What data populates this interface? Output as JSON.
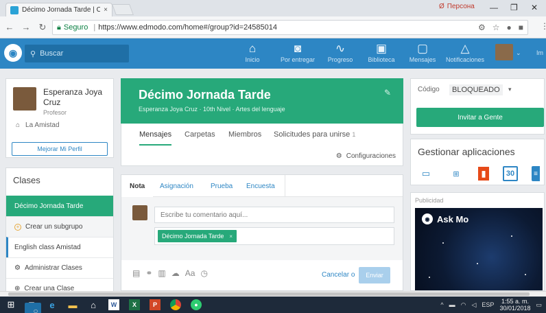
{
  "browser": {
    "tab_title": "Décimo Jornada Tarde | C",
    "tab_close": "×",
    "profile_badge": "Персона",
    "win_minimize": "—",
    "win_maximize": "❐",
    "win_close": "✕",
    "secure_label": "Seguro",
    "url": "https://www.edmodo.com/home#/group?id=24585014"
  },
  "nav": {
    "search_placeholder": "Buscar",
    "items": [
      {
        "label": "Inicio",
        "icon": "home-icon"
      },
      {
        "label": "Por entregar",
        "icon": "camera-icon"
      },
      {
        "label": "Progreso",
        "icon": "progress-icon"
      },
      {
        "label": "Biblioteca",
        "icon": "library-icon"
      },
      {
        "label": "Mensajes",
        "icon": "message-icon"
      },
      {
        "label": "Notificaciones",
        "icon": "bell-icon"
      }
    ],
    "more_label": "Im"
  },
  "profile": {
    "name": "Esperanza Joya Cruz",
    "role": "Profesor",
    "school": "La Amistad",
    "improve_button": "Mejorar Mi Perfil"
  },
  "classes": {
    "title": "Clases",
    "items": [
      {
        "label": "Décimo Jornada Tarde"
      },
      {
        "label": "Crear un subgrupo"
      },
      {
        "label": "English class Amistad"
      },
      {
        "label": "Administrar Clases"
      },
      {
        "label": "Crear una Clase"
      }
    ]
  },
  "group": {
    "title": "Décimo Jornada Tarde",
    "subtitle": "Esperanza Joya Cruz · 10th Nivel · Artes del lenguaje",
    "tabs": [
      {
        "label": "Mensajes"
      },
      {
        "label": "Carpetas"
      },
      {
        "label": "Miembros"
      },
      {
        "label": "Solicitudes para unirse"
      }
    ],
    "requests_count": "1",
    "settings": "Configuraciones"
  },
  "composer": {
    "tabs": [
      "Nota",
      "Asignación",
      "Prueba",
      "Encuesta"
    ],
    "placeholder": "Escribe tu comentario aquí...",
    "recipient": "Décimo Jornada Tarde",
    "recipient_remove": "×",
    "cancel": "Cancelar",
    "or": "o",
    "send": "Enviar"
  },
  "code": {
    "label": "Código",
    "value": "BLOQUEADO",
    "invite_button": "Invitar a Gente"
  },
  "apps": {
    "title": "Gestionar aplicaciones",
    "calendar_number": "30"
  },
  "ad": {
    "label": "Publicidad",
    "brand": "Ask Mo"
  },
  "taskbar": {
    "lang": "ESP",
    "time": "1:55 a. m.",
    "date": "30/01/2018"
  },
  "colors": {
    "brand_blue": "#2d86c4",
    "green": "#27a97a"
  }
}
